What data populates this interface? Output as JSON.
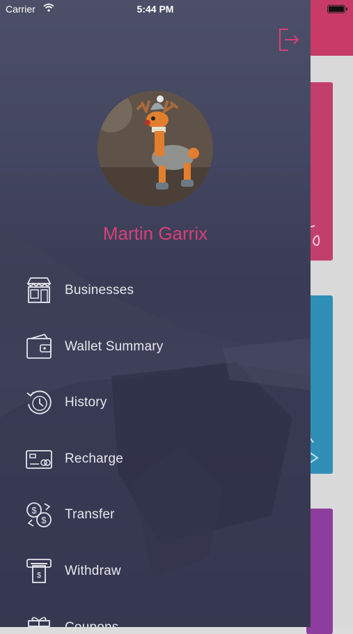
{
  "status_bar": {
    "carrier": "Carrier",
    "time": "5:44 PM"
  },
  "profile": {
    "name": "Martin Garrix"
  },
  "menu": {
    "items": [
      {
        "label": "Businesses",
        "icon": "store-icon"
      },
      {
        "label": "Wallet Summary",
        "icon": "wallet-icon"
      },
      {
        "label": "History",
        "icon": "history-icon"
      },
      {
        "label": "Recharge",
        "icon": "card-icon"
      },
      {
        "label": "Transfer",
        "icon": "transfer-icon"
      },
      {
        "label": "Withdraw",
        "icon": "atm-icon"
      },
      {
        "label": "Coupons",
        "icon": "gift-icon"
      }
    ]
  },
  "colors": {
    "accent": "#d93f78",
    "drawer_bg": "#3c3e58",
    "card1": "#c23f6c",
    "card2": "#2f8fb7",
    "card3": "#8d3d9d"
  }
}
